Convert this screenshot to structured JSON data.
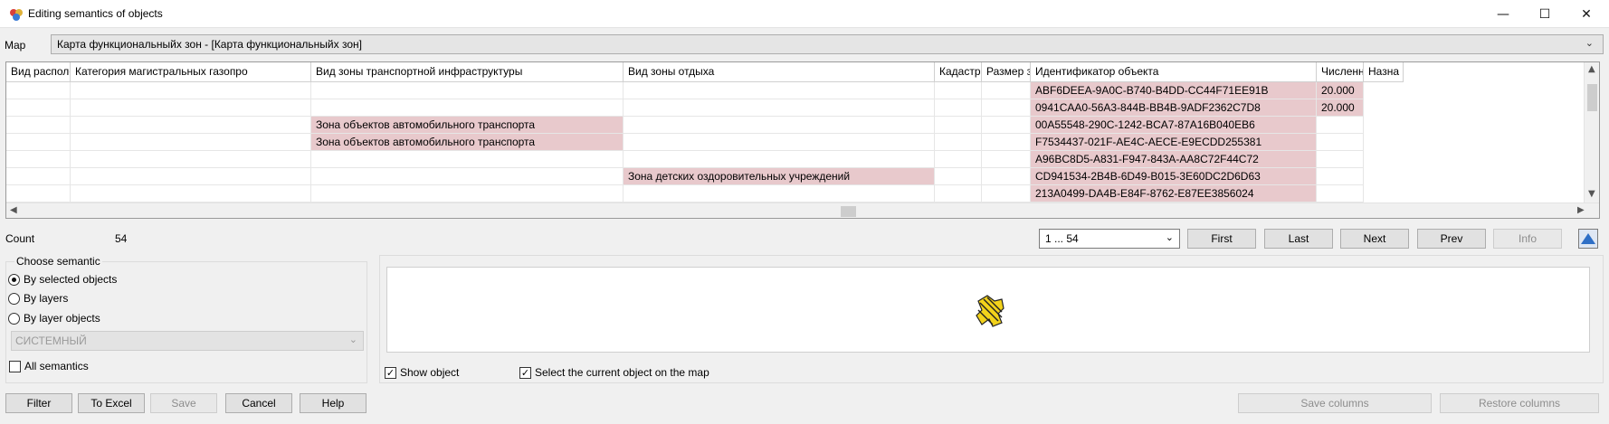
{
  "window": {
    "title": "Editing semantics of objects",
    "minimize_icon": "minimize-icon",
    "maximize_icon": "maximize-icon",
    "close_icon": "close-icon",
    "minimize_glyph": "—",
    "maximize_glyph": "☐",
    "close_glyph": "✕"
  },
  "map": {
    "label": "Map",
    "value": "Карта функциональныйх зон - [Карта функциональныйх зон]"
  },
  "grid": {
    "columns": [
      "Вид располо",
      "Категория магистральных газопро",
      "Вид зоны транспортной инфраструктуры",
      "Вид зоны отдыха",
      "Кадастро",
      "Размер зо",
      "Идентификатор объекта",
      "Численно",
      "Назна"
    ],
    "rows": [
      {
        "transport": "",
        "rest": "",
        "id": "ABF6DEEA-9A0C-B740-B4DD-CC44F71EE91B",
        "num": "20.000"
      },
      {
        "transport": "",
        "rest": "",
        "id": "0941CAA0-56A3-844B-BB4B-9ADF2362C7D8",
        "num": "20.000"
      },
      {
        "transport": "Зона объектов автомобильного транспорта",
        "rest": "",
        "id": "00A55548-290C-1242-BCA7-87A16B040EB6",
        "num": ""
      },
      {
        "transport": "Зона объектов автомобильного транспорта",
        "rest": "",
        "id": "F7534437-021F-AE4C-AECE-E9ECDD255381",
        "num": ""
      },
      {
        "transport": "",
        "rest": "",
        "id": "A96BC8D5-A831-F947-843A-AA8C72F44C72",
        "num": ""
      },
      {
        "transport": "",
        "rest": "Зона детских оздоровительных учреждений",
        "id": "CD941534-2B4B-6D49-B015-3E60DC2D6D63",
        "num": ""
      },
      {
        "transport": "",
        "rest": "",
        "id": "213A0499-DA4B-E84F-8762-E87EE3856024",
        "num": ""
      }
    ],
    "highlight_color": "#e8c9cc"
  },
  "count": {
    "label": "Count",
    "value": "54"
  },
  "nav": {
    "range": "1 ... 54",
    "first": "First",
    "last": "Last",
    "next": "Next",
    "prev": "Prev",
    "info": "Info"
  },
  "semantic": {
    "group_title": "Choose semantic",
    "by_selected": "By selected objects",
    "by_layers": "By layers",
    "by_layer_objects": "By layer objects",
    "layer_value": "СИСТЕМНЫЙ",
    "all_semantics": "All semantics"
  },
  "preview": {
    "show_object": "Show object",
    "select_current": "Select the current object on the map"
  },
  "footer": {
    "filter": "Filter",
    "to_excel": "To Excel",
    "save": "Save",
    "cancel": "Cancel",
    "help": "Help",
    "save_columns": "Save columns",
    "restore_columns": "Restore columns"
  }
}
